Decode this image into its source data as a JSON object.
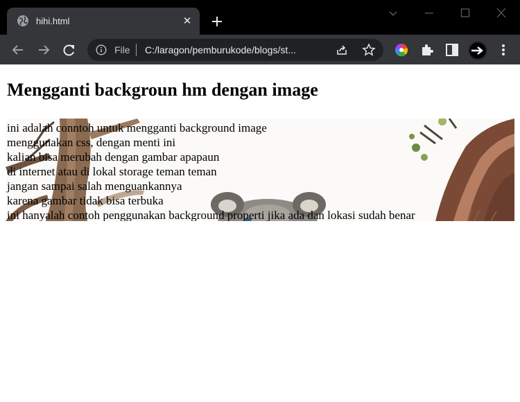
{
  "browser": {
    "tab_title": "hihi.html",
    "tab_close_glyph": "✕",
    "file_label": "File",
    "url": "C:/laragon/pemburukode/blogs/st...",
    "icons": [
      "globe-icon",
      "close-icon",
      "plus-icon",
      "chevron-down-icon",
      "minimize-icon",
      "maximize-icon",
      "window-close-icon",
      "back-arrow-icon",
      "forward-arrow-icon",
      "reload-icon",
      "info-icon",
      "share-icon",
      "star-icon",
      "color-wheel-extension-icon",
      "puzzle-extension-icon",
      "side-panel-icon",
      "profile-avatar-icon",
      "more-menu-icon"
    ],
    "colors": {
      "titlebar": "#000000",
      "toolbar": "#35363a",
      "omnibox": "#202124",
      "text": "#e8eaed"
    }
  },
  "page": {
    "title": "Mengganti backgroun hm dengan image",
    "lines": [
      "ini adalah conntoh untuk mengganti background image",
      "menggunakan css, dengan menti ini",
      "kalian bisa merubah dengan gambar apapaun",
      "di internet atau di lokal storage teman teman",
      "jangan sampai salah menguankannya",
      "karena gambar tidak bisa terbuka",
      "ini hanyalah contoh penggunakan background properti jika ada dan lokasi sudah benar"
    ]
  }
}
